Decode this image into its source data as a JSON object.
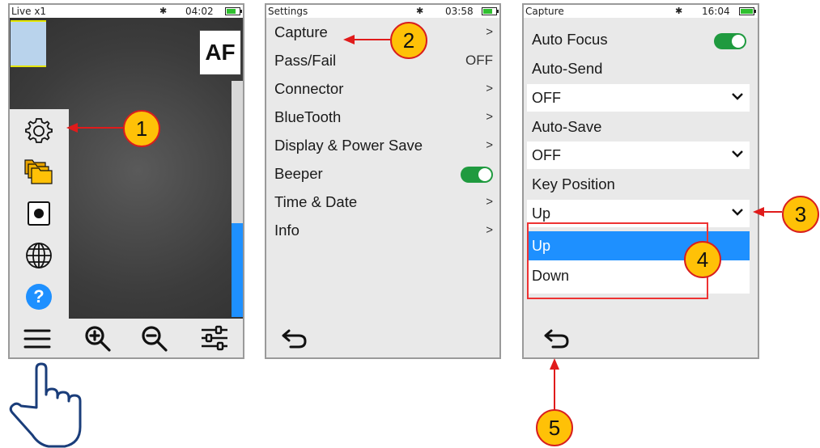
{
  "screen1": {
    "status": {
      "title": "Live x1",
      "time": "04:02",
      "battery_level": 0.7
    },
    "af_label": "AF",
    "menu_icons": [
      "settings-gear-icon",
      "folders-icon",
      "record-icon",
      "globe-icon",
      "help-icon"
    ],
    "help_glyph": "?",
    "toolbar_icons": [
      "hamburger-menu-icon",
      "zoom-in-icon",
      "zoom-out-icon",
      "sliders-icon"
    ],
    "zoom_level": 0.4
  },
  "screen2": {
    "status": {
      "title": "Settings",
      "time": "03:58",
      "battery_level": 0.7
    },
    "rows": [
      {
        "label": "Capture",
        "value": ">"
      },
      {
        "label": "Pass/Fail",
        "value": "OFF"
      },
      {
        "label": "Connector",
        "value": ">"
      },
      {
        "label": "BlueTooth",
        "value": ">"
      },
      {
        "label": "Display & Power Save",
        "value": ">"
      },
      {
        "label": "Beeper",
        "value": ""
      },
      {
        "label": "Time & Date",
        "value": ">"
      },
      {
        "label": "Info",
        "value": ">"
      }
    ],
    "beeper_on": true
  },
  "screen3": {
    "status": {
      "title": "Capture",
      "time": "16:04",
      "battery_state": "charging"
    },
    "auto_focus_label": "Auto Focus",
    "auto_focus_on": true,
    "auto_send_label": "Auto-Send",
    "auto_send_value": "OFF",
    "auto_save_label": "Auto-Save",
    "auto_save_value": "OFF",
    "key_position_label": "Key Position",
    "key_position_value": "Up",
    "options": [
      "Up",
      "Down"
    ],
    "selected_option": "Up"
  },
  "callouts": [
    "1",
    "2",
    "3",
    "4",
    "5"
  ],
  "colors": {
    "accent_blue": "#1e90ff",
    "toggle_green": "#1f9a3f",
    "callout_fill": "#ffc107",
    "arrow_red": "#e01b1b"
  }
}
